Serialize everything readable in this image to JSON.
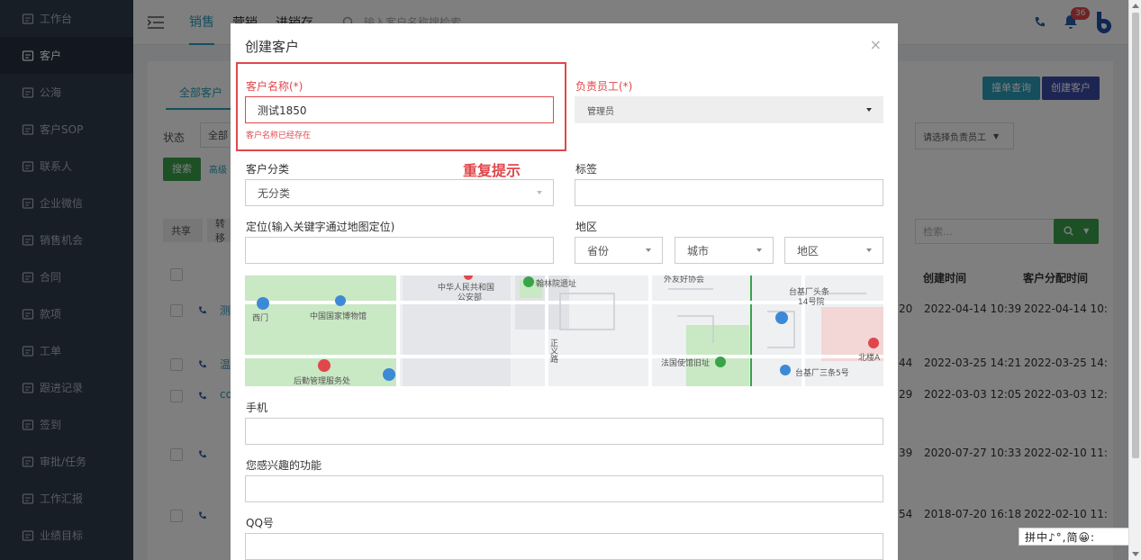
{
  "sidebar": {
    "items": [
      {
        "label": "工作台",
        "icon": "monitor-icon"
      },
      {
        "label": "客户",
        "icon": "building-icon"
      },
      {
        "label": "公海",
        "icon": "anchor-icon"
      },
      {
        "label": "客户SOP",
        "icon": "sop-icon"
      },
      {
        "label": "联系人",
        "icon": "contacts-icon"
      },
      {
        "label": "企业微信",
        "icon": "wecom-icon"
      },
      {
        "label": "销售机会",
        "icon": "bag-icon"
      },
      {
        "label": "合同",
        "icon": "contract-icon"
      },
      {
        "label": "款项",
        "icon": "payment-icon"
      },
      {
        "label": "工单",
        "icon": "ticket-icon"
      },
      {
        "label": "跟进记录",
        "icon": "edit-icon"
      },
      {
        "label": "签到",
        "icon": "checkin-icon"
      },
      {
        "label": "审批/任务",
        "icon": "approval-icon"
      },
      {
        "label": "工作汇报",
        "icon": "report-icon"
      },
      {
        "label": "业绩目标",
        "icon": "target-icon"
      }
    ],
    "active_index": 1
  },
  "topbar": {
    "tabs": [
      "销售",
      "营销",
      "进销存"
    ],
    "search_placeholder": "输入客户名称搜检索",
    "notification_count": "36"
  },
  "background": {
    "sub_tab": "全部客户",
    "btn_check": "撞单查询",
    "btn_create": "创建客户",
    "status_label": "状态",
    "status_value": "全部",
    "search_btn": "搜索",
    "advanced": "高级",
    "share_btn": "共享",
    "transfer_btn": "转移",
    "employee_select": "请选择负责员工",
    "search_placeholder": "检索...",
    "col_created": "创建时间",
    "col_assigned": "客户分配时间",
    "rows": [
      {
        "created": "2022-04-14 10:39",
        "assigned": "2022-04-14 10:",
        "prev": "20"
      },
      {
        "created": "2022-03-25 14:21",
        "assigned": "2022-03-25 14:",
        "prev": "44"
      },
      {
        "created": "2022-03-03 12:05",
        "assigned": "2022-03-03 12:",
        "prev": "29"
      },
      {
        "created": "2020-07-27 10:33",
        "assigned": "2022-02-10 11:",
        "prev": "39"
      },
      {
        "created": "2018-07-20 16:18",
        "assigned": "2022-02-10 11:",
        "prev": "54"
      }
    ],
    "row_chars": [
      "测",
      "温",
      "co",
      "",
      ""
    ]
  },
  "modal": {
    "title": "创建客户",
    "close": "×",
    "customer_name_label": "客户名称(*)",
    "customer_name_value": "测试1850",
    "customer_name_error": "客户名称已经存在",
    "owner_label": "负责员工(*)",
    "owner_value": "管理员",
    "category_label": "客户分类",
    "category_value": "无分类",
    "annotation": "重复提示",
    "tags_label": "标签",
    "location_label": "定位(输入关键字通过地图定位)",
    "region_label": "地区",
    "province": "省份",
    "city": "城市",
    "district": "地区",
    "phone_label": "手机",
    "interest_label": "您感兴趣的功能",
    "qq_label": "QQ号"
  },
  "map": {
    "labels": [
      "中华人民共和国",
      "公安部",
      "翰林院遗址",
      "外友好协会",
      "台基厂头条",
      "14号院",
      "西门",
      "中国国家博物馆",
      "正义路",
      "法国使馆旧址",
      "北楼A",
      "台基厂三条5号",
      "后勤管理服务处"
    ]
  },
  "ime": {
    "text": "拼中♪°,简😀:"
  },
  "colors": {
    "accent": "#2a9dba",
    "error": "#e0474c",
    "sidebar_bg": "#2f3c4d",
    "create_btn": "#3b4ba6",
    "search_green": "#3aa34a"
  }
}
